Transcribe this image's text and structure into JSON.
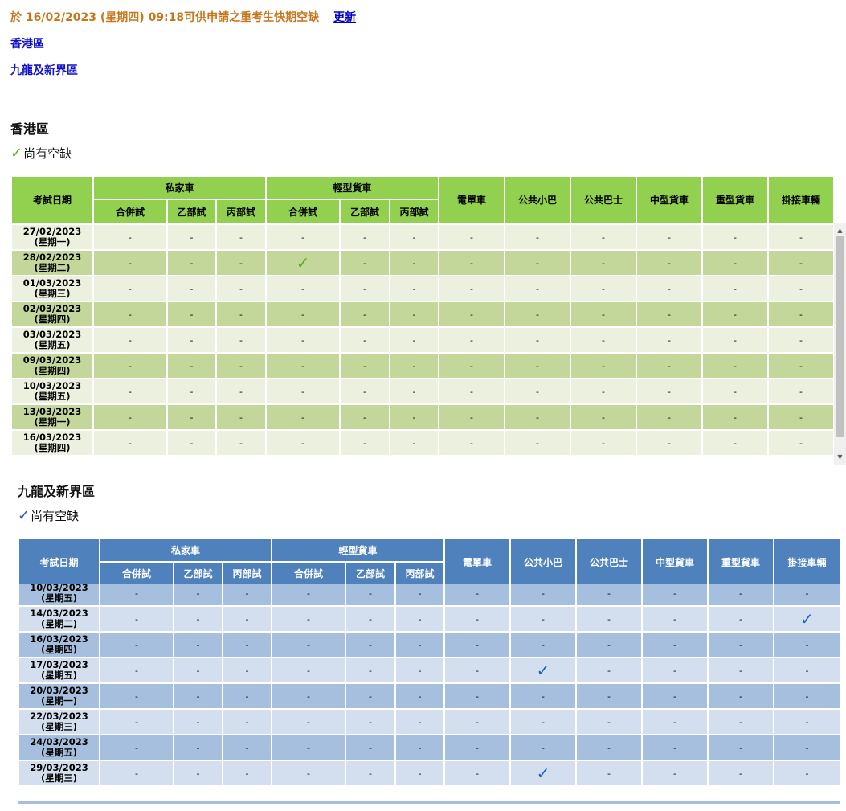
{
  "header": {
    "status_text": "於 16/02/2023 (星期四) 09:18可供申請之重考生快期空缺",
    "refresh_link": "更新"
  },
  "nav": {
    "hk_link": "香港區",
    "kln_link": "九龍及新界區"
  },
  "columns": {
    "date": "考試日期",
    "group_private": "私家車",
    "group_lgv": "輕型貨車",
    "sub_combined": "合併試",
    "sub_b": "乙部試",
    "sub_c": "丙部試",
    "motorcycle": "電單車",
    "light_bus": "公共小巴",
    "bus": "公共巴士",
    "mgv": "中型貨車",
    "hgv": "重型貨車",
    "articulated": "掛接車輛"
  },
  "legend_text": "尚有空缺",
  "dash": "-",
  "check": "✓",
  "colors": {
    "header_text": "#c7761c",
    "hk_header": "#92d050",
    "hk_row_light": "#ebf1de",
    "hk_row_dark": "#c4d79b",
    "kl_header": "#4f81bd",
    "kl_row_dark": "#a7bfde",
    "kl_row_light": "#d3dfee"
  },
  "hk": {
    "title": "香港區",
    "rows": [
      {
        "date": "27/02/2023",
        "day": "(星期一)",
        "checks": []
      },
      {
        "date": "28/02/2023",
        "day": "(星期二)",
        "checks": [
          4
        ]
      },
      {
        "date": "01/03/2023",
        "day": "(星期三)",
        "checks": []
      },
      {
        "date": "02/03/2023",
        "day": "(星期四)",
        "checks": []
      },
      {
        "date": "03/03/2023",
        "day": "(星期五)",
        "checks": []
      },
      {
        "date": "09/03/2023",
        "day": "(星期四)",
        "checks": []
      },
      {
        "date": "10/03/2023",
        "day": "(星期五)",
        "checks": []
      },
      {
        "date": "13/03/2023",
        "day": "(星期一)",
        "checks": []
      },
      {
        "date": "16/03/2023",
        "day": "(星期四)",
        "checks": []
      }
    ]
  },
  "kl": {
    "title": "九龍及新界區",
    "rows": [
      {
        "date": "10/03/2023",
        "day": "(星期五)",
        "checks": []
      },
      {
        "date": "14/03/2023",
        "day": "(星期二)",
        "checks": [
          12
        ]
      },
      {
        "date": "16/03/2023",
        "day": "(星期四)",
        "checks": []
      },
      {
        "date": "17/03/2023",
        "day": "(星期五)",
        "checks": [
          8
        ]
      },
      {
        "date": "20/03/2023",
        "day": "(星期一)",
        "checks": []
      },
      {
        "date": "22/03/2023",
        "day": "(星期三)",
        "checks": []
      },
      {
        "date": "24/03/2023",
        "day": "(星期五)",
        "checks": []
      },
      {
        "date": "29/03/2023",
        "day": "(星期三)",
        "checks": [
          8
        ]
      }
    ]
  }
}
